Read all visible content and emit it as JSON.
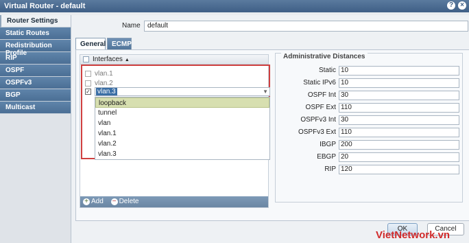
{
  "window": {
    "title": "Virtual Router - default"
  },
  "sidebar": {
    "items": [
      {
        "label": "Router Settings"
      },
      {
        "label": "Static Routes"
      },
      {
        "label": "Redistribution Profile"
      },
      {
        "label": "RIP"
      },
      {
        "label": "OSPF"
      },
      {
        "label": "OSPFv3"
      },
      {
        "label": "BGP"
      },
      {
        "label": "Multicast"
      }
    ],
    "active_index": 0
  },
  "form": {
    "name_label": "Name",
    "name_value": "default"
  },
  "tabs": [
    {
      "label": "General",
      "active": true
    },
    {
      "label": "ECMP",
      "active": false
    }
  ],
  "interfaces": {
    "header": "Interfaces",
    "rows": [
      {
        "name": "vlan.1",
        "checked": false
      },
      {
        "name": "vlan.2",
        "checked": false
      }
    ],
    "dropdown_current": "vlan.3",
    "dropdown_options": [
      "loopback",
      "tunnel",
      "vlan",
      "vlan.1",
      "vlan.2",
      "vlan.3"
    ],
    "highlighted_option": "loopback",
    "add_label": "Add",
    "delete_label": "Delete"
  },
  "admin_distances": {
    "title": "Administrative Distances",
    "rows": [
      {
        "label": "Static",
        "value": "10"
      },
      {
        "label": "Static IPv6",
        "value": "10"
      },
      {
        "label": "OSPF Int",
        "value": "30"
      },
      {
        "label": "OSPF Ext",
        "value": "110"
      },
      {
        "label": "OSPFv3 Int",
        "value": "30"
      },
      {
        "label": "OSPFv3 Ext",
        "value": "110"
      },
      {
        "label": "IBGP",
        "value": "200"
      },
      {
        "label": "EBGP",
        "value": "20"
      },
      {
        "label": "RIP",
        "value": "120"
      }
    ]
  },
  "buttons": {
    "ok": "OK",
    "cancel": "Cancel"
  },
  "watermark": "VietNetwork.vn"
}
